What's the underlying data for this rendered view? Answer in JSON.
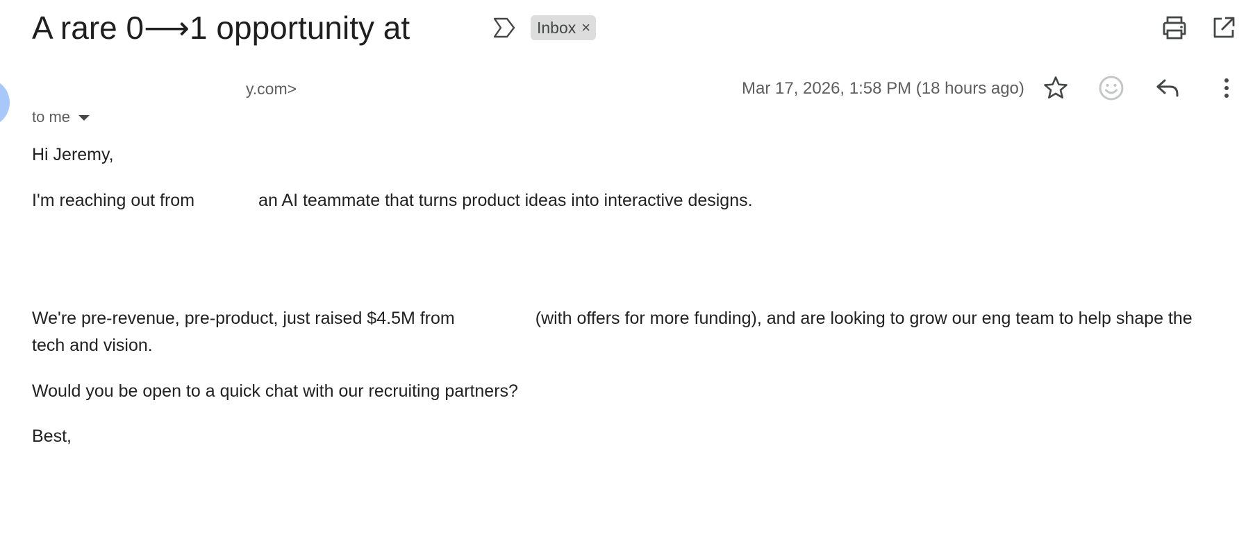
{
  "header": {
    "subject": "A rare 0⟶1 opportunity at",
    "label_chip": "Inbox",
    "label_chip_close": "×",
    "icons": [
      "important-marker-icon",
      "print-icon",
      "open-in-new-window-icon"
    ]
  },
  "message": {
    "sender_email_fragment": "y.com>",
    "recipient": "to me",
    "date": "Mar 17, 2026, 1:58 PM (18 hours ago)",
    "icons": [
      "star-icon",
      "emoji-reaction-icon",
      "reply-icon",
      "more-options-icon"
    ]
  },
  "body": {
    "greeting": "Hi Jeremy,",
    "intro_start": "I'm reaching out from",
    "intro_end": "an AI teammate that turns product ideas into interactive designs.",
    "funding_start": "We're pre-revenue, pre-product, just raised $4.5M from",
    "funding_end": "(with offers for more funding), and are looking to grow our eng team to help shape the tech and vision.",
    "question": "Would you be open to a quick chat with our recruiting partners?",
    "signoff": "Best,"
  },
  "colors": {
    "avatar": "#a8c7fa",
    "chip_background": "#dddddd",
    "secondary_text": "#5e5e5e",
    "icon": "#444746"
  }
}
